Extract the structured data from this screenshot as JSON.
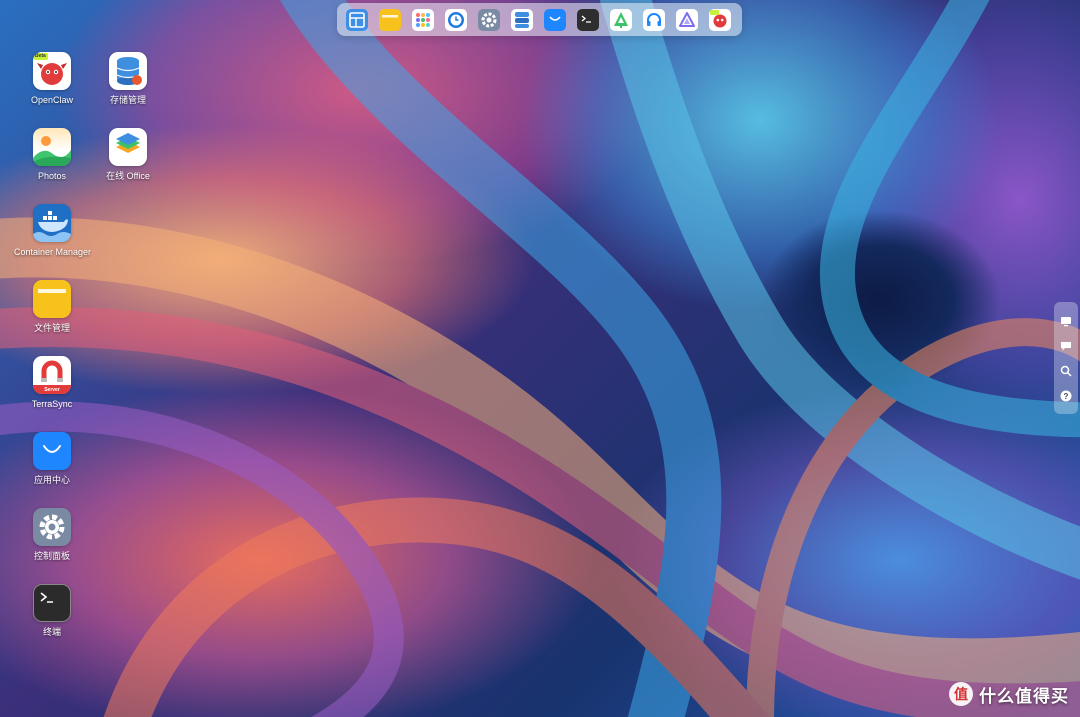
{
  "dock": {
    "items": [
      {
        "icon": "layout-grid-icon",
        "color": "#3d8ee6"
      },
      {
        "icon": "file-manager-icon",
        "color": "#f7c21b"
      },
      {
        "icon": "app-grid-icon",
        "color": "#ffffff"
      },
      {
        "icon": "clock-icon",
        "color": "#1f7ae0"
      },
      {
        "icon": "settings-icon",
        "color": "#7a8aa3"
      },
      {
        "icon": "storage-icon",
        "color": "#3f8fe0"
      },
      {
        "icon": "app-center-icon",
        "color": "#1e86ff"
      },
      {
        "icon": "terminal-icon",
        "color": "#2e2e2e"
      },
      {
        "icon": "tree-icon",
        "color": "#3cc36a"
      },
      {
        "icon": "headset-icon",
        "color": "#1e86ff"
      },
      {
        "icon": "prism-icon",
        "color": "#7b6cf0"
      },
      {
        "icon": "openclaw-icon",
        "color": "#e23b3b"
      }
    ]
  },
  "desktop": {
    "icons": [
      {
        "label": "OpenClaw",
        "icon": "openclaw-icon",
        "badge": "Beta"
      },
      {
        "label": "存储管理",
        "icon": "storage-manager-icon"
      },
      {
        "label": "Photos",
        "icon": "photos-icon"
      },
      {
        "label": "在线 Office",
        "icon": "office-layers-icon"
      },
      {
        "label": "Container Manager",
        "icon": "docker-whale-icon"
      },
      {
        "label": "文件管理",
        "icon": "folder-icon"
      },
      {
        "label": "TerraSync",
        "icon": "terrasync-magnet-icon",
        "badge": "Server"
      },
      {
        "label": "应用中心",
        "icon": "app-center-bag-icon"
      },
      {
        "label": "控制面板",
        "icon": "gear-icon"
      },
      {
        "label": "终端",
        "icon": "terminal-icon"
      }
    ]
  },
  "side_panel": {
    "items": [
      {
        "icon": "monitor-icon"
      },
      {
        "icon": "chat-icon"
      },
      {
        "icon": "search-icon"
      },
      {
        "icon": "help-icon"
      }
    ]
  },
  "watermark": {
    "badge": "值",
    "text": "什么值得买"
  }
}
